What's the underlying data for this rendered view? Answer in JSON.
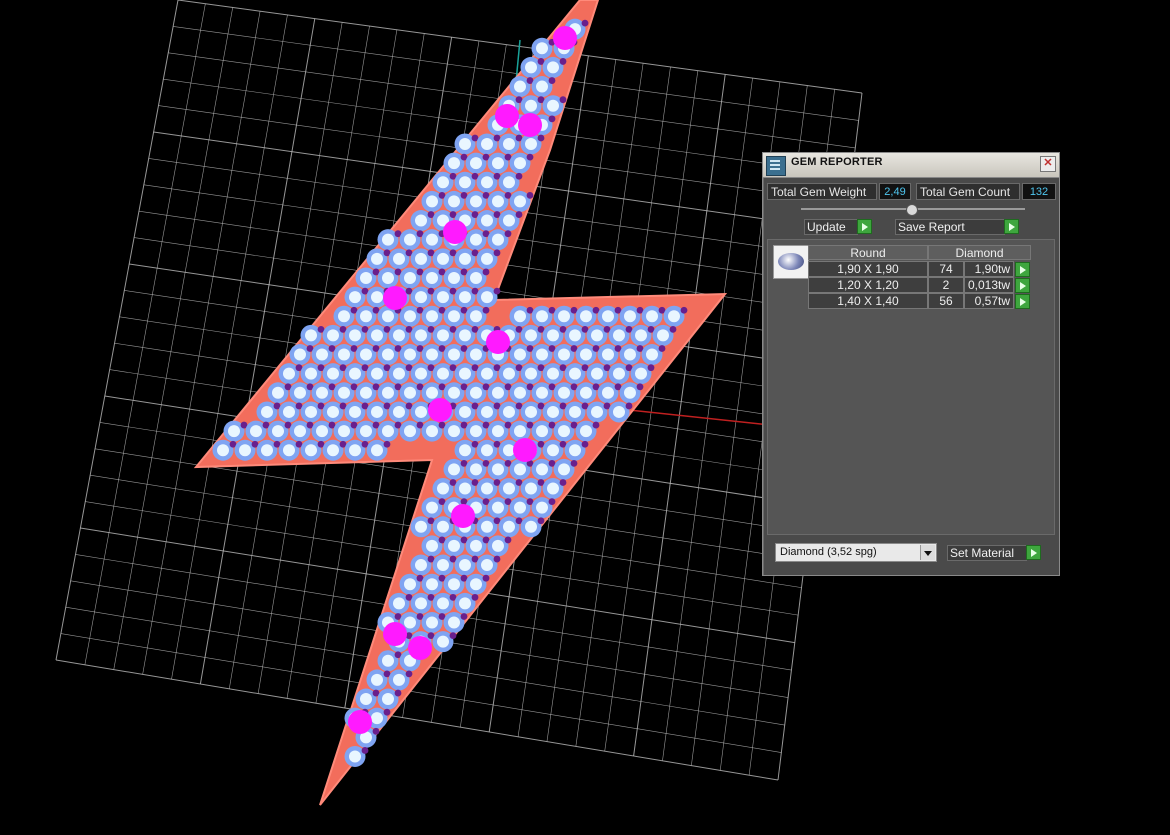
{
  "panel": {
    "title": "GEM REPORTER",
    "close_glyph": "✕",
    "total_weight_label": "Total Gem Weight",
    "total_weight_value": "2,49",
    "total_count_label": "Total Gem Count",
    "total_count_value": "132",
    "update_label": "Update",
    "save_report_label": "Save Report",
    "table": {
      "headers": [
        "Round",
        "Diamond"
      ],
      "rows": [
        {
          "size": "1,90 X 1,90",
          "count": "74",
          "weight": "1,90tw"
        },
        {
          "size": "1,20 X 1,20",
          "count": "2",
          "weight": "0,013tw"
        },
        {
          "size": "1,40 X 1,40",
          "count": "56",
          "weight": "0,57tw"
        }
      ]
    },
    "material_select": "Diamond     (3,52 spg)",
    "set_material_label": "Set Material"
  },
  "colors": {
    "background": "#000000",
    "grid": "#bdbdbd",
    "metal": "#f26d5c",
    "gem_blue": "#7fa4f2",
    "gem_center": "#e9f6ff",
    "prong_purple": "#6a1f8c",
    "marker_magenta": "#ff1aff",
    "accent_cyan": "#4fc6ef"
  }
}
